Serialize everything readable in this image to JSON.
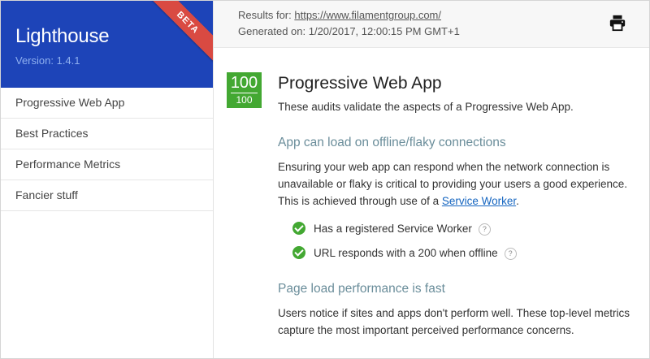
{
  "app": {
    "title": "Lighthouse",
    "version": "Version: 1.4.1",
    "badge": "BETA",
    "brand_color": "#1d44b8",
    "ribbon_color": "#d94a42"
  },
  "sidebar": {
    "items": [
      {
        "label": "Progressive Web App"
      },
      {
        "label": "Best Practices"
      },
      {
        "label": "Performance Metrics"
      },
      {
        "label": "Fancier stuff"
      }
    ]
  },
  "header": {
    "results_label": "Results for: ",
    "results_url": "https://www.filamentgroup.com/",
    "generated": "Generated on: 1/20/2017, 12:00:15 PM GMT+1",
    "print_icon": "print-icon"
  },
  "main": {
    "score": {
      "value": "100",
      "total": "100",
      "color": "#43a832"
    },
    "title": "Progressive Web App",
    "intro": "These audits validate the aspects of a Progressive Web App.",
    "sections": [
      {
        "heading": "App can load on offline/flaky connections",
        "text_before_link": "Ensuring your web app can respond when the network connection is unavailable or flaky is critical to providing your users a good experience. This is achieved through use of a ",
        "link": "Service Worker",
        "text_after_link": ".",
        "audits": [
          {
            "label": "Has a registered Service Worker",
            "help": "?"
          },
          {
            "label": "URL responds with a 200 when offline",
            "help": "?"
          }
        ]
      },
      {
        "heading": "Page load performance is fast",
        "text": "Users notice if sites and apps don't perform well. These top-level metrics capture the most important perceived performance concerns."
      }
    ]
  }
}
